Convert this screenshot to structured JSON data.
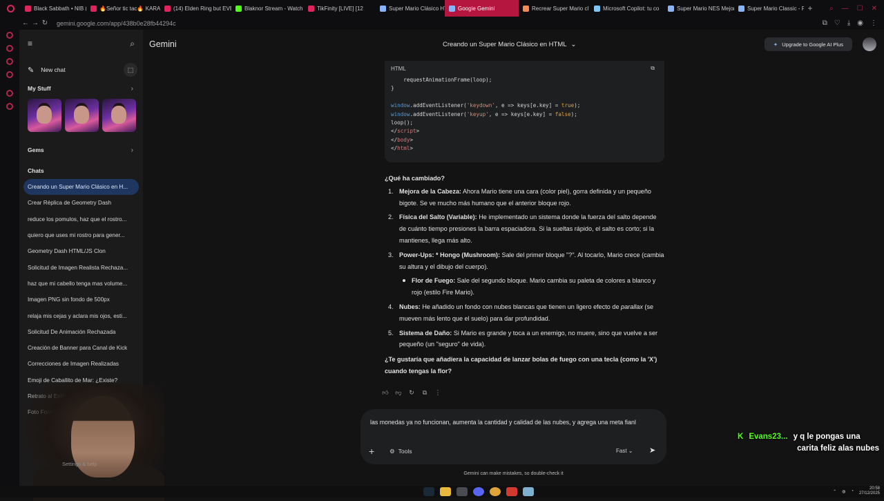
{
  "browser": {
    "tabs": [
      {
        "label": "Black Sabbath • NIB (O",
        "color": "#e0245e"
      },
      {
        "label": "🔥Señor tic tac🔥 KARA",
        "color": "#e0245e"
      },
      {
        "label": "(14) Elden Ring but EVE",
        "color": "#e0245e"
      },
      {
        "label": "Blaknor Stream - Watch",
        "color": "#53fc18"
      },
      {
        "label": "TikFinity [LIVE] [12",
        "color": "#e0245e"
      },
      {
        "label": "Super Mario Clásico HT",
        "color": "#8ab4f8"
      },
      {
        "label": "Google Gemini",
        "color": "#8ab4f8",
        "active": true
      },
      {
        "label": "Recrear Super Mario cl",
        "color": "#f28b54"
      },
      {
        "label": "Microsoft Copilot: tu co",
        "color": "#7fc6f5"
      },
      {
        "label": "Super Mario NES Mejor",
        "color": "#8ab4f8"
      },
      {
        "label": "Super Mario Classic - F",
        "color": "#8ab4f8"
      }
    ],
    "url": "gemini.google.com/app/438b0e28fb44294c"
  },
  "sidebar": {
    "new_chat": "New chat",
    "my_stuff": "My Stuff",
    "gems": "Gems",
    "chats_heading": "Chats",
    "chats": [
      {
        "label": "Creando un Super Mario Clásico en H...",
        "active": true
      },
      {
        "label": "Crear Réplica de Geometry Dash"
      },
      {
        "label": "reduce los pomulos, haz que el rostro..."
      },
      {
        "label": "quiero que uses mi rostro para gener..."
      },
      {
        "label": "Geometry Dash HTML/JS Clon"
      },
      {
        "label": "Solicitud de Imagen Realista Rechaza..."
      },
      {
        "label": "haz que mi cabello tenga mas volume..."
      },
      {
        "label": "Imagen PNG sin fondo de 500px"
      },
      {
        "label": "relaja mis cejas y aclara mis ojos, esti..."
      },
      {
        "label": "Solicitud De Animación Rechazada"
      },
      {
        "label": "Creación de Banner para Canal de Kick"
      },
      {
        "label": "Correcciones de Imagen Realizadas"
      },
      {
        "label": "Emoji de Caballito de Mar: ¿Existe?"
      },
      {
        "label": "Retrato al Estilo Studio Gh"
      },
      {
        "label": "Foto Formal Para Trám"
      }
    ],
    "settings_partial": "Settings & help"
  },
  "header": {
    "brand": "Gemini",
    "conversation_title": "Creando un Super Mario Clásico en HTML",
    "upgrade_label": "Upgrade to Google AI Plus"
  },
  "code_block": {
    "language": "HTML"
  },
  "response": {
    "heading": "¿Qué ha cambiado?",
    "items": [
      {
        "num": "1.",
        "title": "Mejora de la Cabeza:",
        "text": " Ahora Mario tiene una cara (color piel), gorra definida y un pequeño bigote. Se ve mucho más humano que el anterior bloque rojo."
      },
      {
        "num": "2.",
        "title": "Física del Salto (Variable):",
        "text": " He implementado un sistema donde la fuerza del salto depende de cuánto tiempo presiones la barra espaciadora. Si la sueltas rápido, el salto es corto; si la mantienes, llega más alto."
      },
      {
        "num": "3.",
        "title": "Power-Ups: * Hongo (Mushroom):",
        "text": " Sale del primer bloque \"?\". Al tocarlo, Mario crece (cambia su altura y el dibujo del cuerpo)."
      }
    ],
    "sub_item": {
      "title": "Flor de Fuego:",
      "text": " Sale del segundo bloque. Mario cambia su paleta de colores a blanco y rojo (estilo Fire Mario)."
    },
    "items2": [
      {
        "num": "4.",
        "title": "Nubes:",
        "text_a": " He añadido un fondo con nubes blancas que tienen un ligero efecto de ",
        "italic": "parallax",
        "text_b": " (se mueven más lento que el suelo) para dar profundidad."
      },
      {
        "num": "5.",
        "title": "Sistema de Daño:",
        "text": " Si Mario es grande y toca a un enemigo, no muere, sino que vuelve a ser pequeño (un \"seguro\" de vida)."
      }
    ],
    "question": "¿Te gustaría que añadiera la capacidad de lanzar bolas de fuego con una tecla (como la 'X') cuando tengas la flor?"
  },
  "composer": {
    "text": "las monedas ya no funcionan, aumenta la cantidad y calidad de las nubes, y agrega una meta fianl",
    "tools_label": "Tools",
    "mode_label": "Fast",
    "disclaimer": "Gemini can make mistakes, so double-check it"
  },
  "stream_overlay": {
    "user": "Evans23...",
    "message_line1": "y q le pongas una",
    "message_line2": "carita feliz alas nubes"
  },
  "taskbar": {
    "time": "20:58",
    "date": "27/12/2025"
  }
}
